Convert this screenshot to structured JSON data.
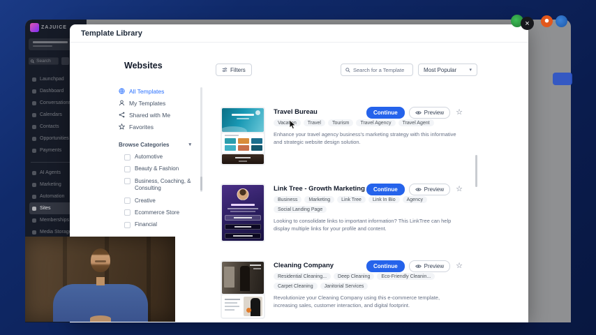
{
  "colors": {
    "accent_blue": "#2563eb",
    "active_link_blue": "#2970ff",
    "desktop_navy": "#0a1c4e",
    "sidebar_dark": "#161b27",
    "dim_overlay_grey": "#8f9092"
  },
  "sidebar": {
    "brand": "ZAJUICE",
    "search_placeholder": "Search",
    "nav_primary": [
      {
        "label": "Launchpad"
      },
      {
        "label": "Dashboard"
      },
      {
        "label": "Conversations"
      },
      {
        "label": "Calendars"
      },
      {
        "label": "Contacts"
      },
      {
        "label": "Opportunities"
      },
      {
        "label": "Payments"
      }
    ],
    "nav_secondary": [
      {
        "label": "AI Agents",
        "active": false
      },
      {
        "label": "Marketing",
        "active": false
      },
      {
        "label": "Automation",
        "active": false
      },
      {
        "label": "Sites",
        "active": true
      },
      {
        "label": "Memberships",
        "active": false
      },
      {
        "label": "Media Storage",
        "active": false
      }
    ]
  },
  "modal": {
    "title": "Template Library",
    "section_title": "Websites",
    "filters_label": "Filters",
    "search_placeholder": "Search for a Template",
    "sort_value": "Most Popular",
    "nav": [
      {
        "label": "All Templates",
        "icon": "globe-icon",
        "active": true
      },
      {
        "label": "My Templates",
        "icon": "user-icon",
        "active": false
      },
      {
        "label": "Shared with Me",
        "icon": "share-icon",
        "active": false
      },
      {
        "label": "Favorites",
        "icon": "star-icon",
        "active": false
      }
    ],
    "browse_categories_label": "Browse Categories",
    "categories": [
      "Automotive",
      "Beauty & Fashion",
      "Business, Coaching, & Consulting",
      "Creative",
      "Ecommerce Store",
      "Financial"
    ],
    "actions": {
      "continue_label": "Continue",
      "preview_label": "Preview",
      "favorite_glyph": "☆"
    },
    "templates": [
      {
        "name": "Travel Bureau",
        "tags": [
          "Vacation",
          "Travel",
          "Tourism",
          "Travel Agency",
          "Travel Agent"
        ],
        "description": "Enhance your travel agency business's marketing strategy with this informative and strategic website design solution.",
        "thumb": "travel"
      },
      {
        "name": "Link Tree - Growth Marketing",
        "tags": [
          "Business",
          "Marketing",
          "Link Tree",
          "Link In Bio",
          "Agency",
          "Social Landing Page"
        ],
        "description": "Looking to consolidate links to important information? This LinkTree can help display multiple links for your profile and content.",
        "thumb": "linktree"
      },
      {
        "name": "Cleaning Company",
        "tags": [
          "Residential Cleaning...",
          "Deep Cleaning",
          "Eco-Friendly Cleanin...",
          "Carpet Cleaning",
          "Janitorial Services"
        ],
        "description": "Revolutionize your Cleaning Company using this e-commerce template, increasing sales, customer interaction, and digital footprint.",
        "thumb": "cleaning"
      }
    ],
    "close_glyph": "×"
  }
}
